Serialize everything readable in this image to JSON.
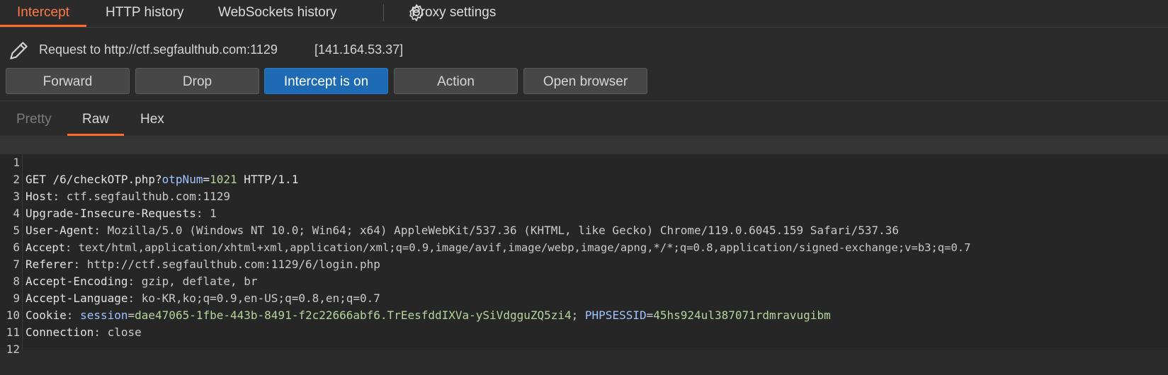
{
  "topnav": {
    "tabs": [
      "Intercept",
      "HTTP history",
      "WebSockets history"
    ],
    "settings_label": "Proxy settings",
    "accent": "#ff6a2b"
  },
  "request": {
    "label": "Request to http://ctf.segfaulthub.com:1129",
    "ip": "[141.164.53.37]",
    "icon": "pencil-icon"
  },
  "toolbar": {
    "forward": "Forward",
    "drop": "Drop",
    "intercept": "Intercept is on",
    "action": "Action",
    "open_browser": "Open browser"
  },
  "subtabs": [
    "Pretty",
    "Raw",
    "Hex"
  ],
  "editor": {
    "line_numbers": [
      "1",
      "2",
      "3",
      "4",
      "5",
      "6",
      "7",
      "8",
      "9",
      "10",
      "11",
      "12"
    ],
    "l1": {
      "method_path": "GET /6/checkOTP.php?",
      "param": "otpNum",
      "eq": "=",
      "value": "1021",
      "proto": " HTTP/1.1"
    },
    "headers": [
      {
        "name": "Host",
        "value": " ctf.segfaulthub.com:1129"
      },
      {
        "name": "Upgrade-Insecure-Requests",
        "value": " 1"
      },
      {
        "name": "User-Agent",
        "value": " Mozilla/5.0 (Windows NT 10.0; Win64; x64) AppleWebKit/537.36 (KHTML, like Gecko) Chrome/119.0.6045.159 Safari/537.36"
      },
      {
        "name": "Accept",
        "value": " text/html,application/xhtml+xml,application/xml;q=0.9,image/avif,image/webp,image/apng,*/*;q=0.8,application/signed-exchange;v=b3;q=0.7"
      },
      {
        "name": "Referer",
        "value": " http://ctf.segfaulthub.com:1129/6/login.php"
      },
      {
        "name": "Accept-Encoding",
        "value": " gzip, deflate, br"
      },
      {
        "name": "Accept-Language",
        "value": " ko-KR,ko;q=0.9,en-US;q=0.8,en;q=0.7"
      }
    ],
    "cookie": {
      "name": "Cookie",
      "p1": "session",
      "v1": "dae47065-1fbe-443b-8491-f2c22666abf6.TrEesfddIXVa-ySiVdgguZQ5zi4",
      "sep": "; ",
      "p2": "PHPSESSID",
      "v2": "45hs924ul387071rdmravugibm"
    },
    "connection": {
      "name": "Connection",
      "value": " close"
    }
  }
}
